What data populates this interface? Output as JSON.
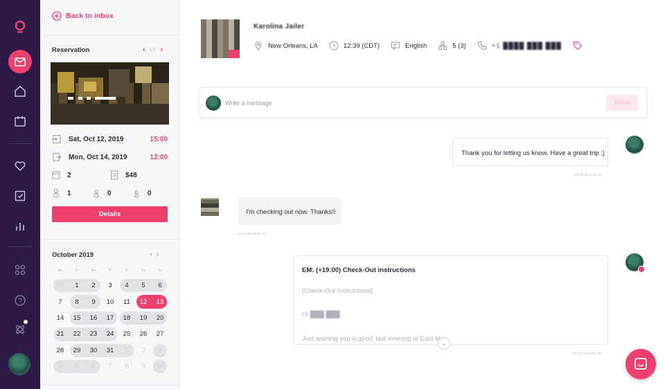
{
  "colors": {
    "accent": "#ef3f6f",
    "rail_bg": "#2d1a49",
    "sidebar_bg": "#f7f7f9"
  },
  "rail": {
    "items": [
      {
        "icon": "logo-icon"
      },
      {
        "icon": "inbox-icon",
        "active": true
      },
      {
        "icon": "home-icon"
      },
      {
        "icon": "calendar-icon"
      },
      {
        "icon": "heart-icon"
      },
      {
        "icon": "checkbox-icon"
      },
      {
        "icon": "bar-chart-icon"
      },
      {
        "icon": "apps-grid-icon"
      },
      {
        "icon": "help-icon"
      },
      {
        "icon": "integrations-icon"
      },
      {
        "icon": "user-avatar"
      }
    ]
  },
  "sidebar": {
    "back_label": "Back to inbox",
    "reservation": {
      "title": "Reservation",
      "pager": "1/1",
      "checkin_date": "Sat, Oct 12, 2019",
      "checkin_time": "15:00",
      "checkout_date": "Mon, Oct 14, 2019",
      "checkout_time": "12:00",
      "nights": "2",
      "price": "$48",
      "adults": "1",
      "children": "0",
      "infants": "0",
      "details_label": "Details"
    },
    "calendar": {
      "month": "October 2019",
      "dows": [
        "Mo",
        "Tu",
        "We",
        "Th",
        "Fr",
        "Sa",
        "Su"
      ],
      "days": [
        {
          "d": "30",
          "m": true,
          "b": "start"
        },
        {
          "d": "1",
          "b": "mid"
        },
        {
          "d": "2",
          "b": "end"
        },
        {
          "d": "3"
        },
        {
          "d": "4",
          "b": "start"
        },
        {
          "d": "5",
          "b": "mid"
        },
        {
          "d": "6",
          "b": "end"
        },
        {
          "d": "7"
        },
        {
          "d": "8",
          "b": "start"
        },
        {
          "d": "9",
          "b": "end"
        },
        {
          "d": "10"
        },
        {
          "d": "11"
        },
        {
          "d": "12",
          "s": "start"
        },
        {
          "d": "13",
          "s": "end"
        },
        {
          "d": "14"
        },
        {
          "d": "15",
          "b": "start"
        },
        {
          "d": "16",
          "b": "mid"
        },
        {
          "d": "17",
          "b": "end"
        },
        {
          "d": "18",
          "b": "start"
        },
        {
          "d": "19",
          "b": "mid"
        },
        {
          "d": "20",
          "b": "end"
        },
        {
          "d": "21",
          "b": "start"
        },
        {
          "d": "22",
          "b": "mid"
        },
        {
          "d": "23",
          "b": "mid"
        },
        {
          "d": "24",
          "b": "end"
        },
        {
          "d": "25"
        },
        {
          "d": "26"
        },
        {
          "d": "27"
        },
        {
          "d": "28"
        },
        {
          "d": "29",
          "b": "start"
        },
        {
          "d": "30",
          "b": "mid"
        },
        {
          "d": "31",
          "b": "mid"
        },
        {
          "d": "1",
          "m": true,
          "b": "end"
        },
        {
          "d": "2",
          "m": true
        },
        {
          "d": "3",
          "m": true,
          "b": "single"
        },
        {
          "d": "4",
          "m": true,
          "b": "start"
        },
        {
          "d": "5",
          "m": true,
          "b": "mid"
        },
        {
          "d": "6",
          "m": true,
          "b": "end"
        },
        {
          "d": "7",
          "m": true
        },
        {
          "d": "8",
          "m": true
        },
        {
          "d": "9",
          "m": true
        },
        {
          "d": "10",
          "m": true,
          "b": "single"
        }
      ]
    }
  },
  "guest": {
    "name": "Karolina Jailer",
    "location": "New Orleans, LA",
    "local_time": "12:39 (CDT)",
    "language": "English",
    "stays": "5 (3)",
    "phone": "+1 ████ ███ ███"
  },
  "composer": {
    "placeholder": "Write a message",
    "send_label": "Send"
  },
  "messages": [
    {
      "direction": "out",
      "text": "Thank you for letting us know. Have a great trip :)",
      "timestamp": "Oct 14 '19 10:10 +07"
    },
    {
      "direction": "in",
      "text": "I'm checking out now. Thanks!!",
      "timestamp": "Oct 14 '19 09:40 +07"
    },
    {
      "direction": "out",
      "automated": true,
      "title": "EM: (+19:00) Check-Out instructions",
      "line1": "[Check-Out Instructions]",
      "line2": "Hi ███ ███",
      "line3": "Just wishing you a good, last evening at East Mo",
      "timestamp": "Oct 13 '19 19:00 +07"
    }
  ]
}
